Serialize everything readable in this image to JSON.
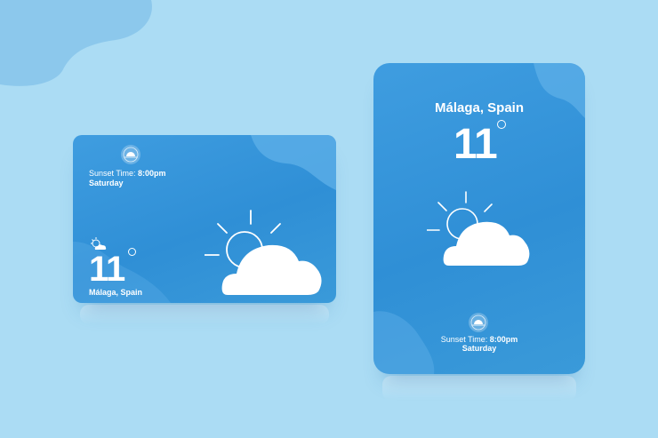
{
  "colors": {
    "background": "#abdcf4",
    "card": "#2f8fd6",
    "card_accent": "#5fb0e8",
    "text": "#ffffff"
  },
  "widget_horizontal": {
    "sunset_label": "Sunset Time:",
    "sunset_time": "8:00pm",
    "day": "Saturday",
    "temperature": "11",
    "city": "Málaga, Spain",
    "weather_icon": "partly-cloudy-icon"
  },
  "widget_vertical": {
    "city": "Málaga, Spain",
    "temperature": "11",
    "sunset_label": "Sunset Time:",
    "sunset_time": "8:00pm",
    "day": "Saturday",
    "weather_icon": "partly-cloudy-icon"
  }
}
